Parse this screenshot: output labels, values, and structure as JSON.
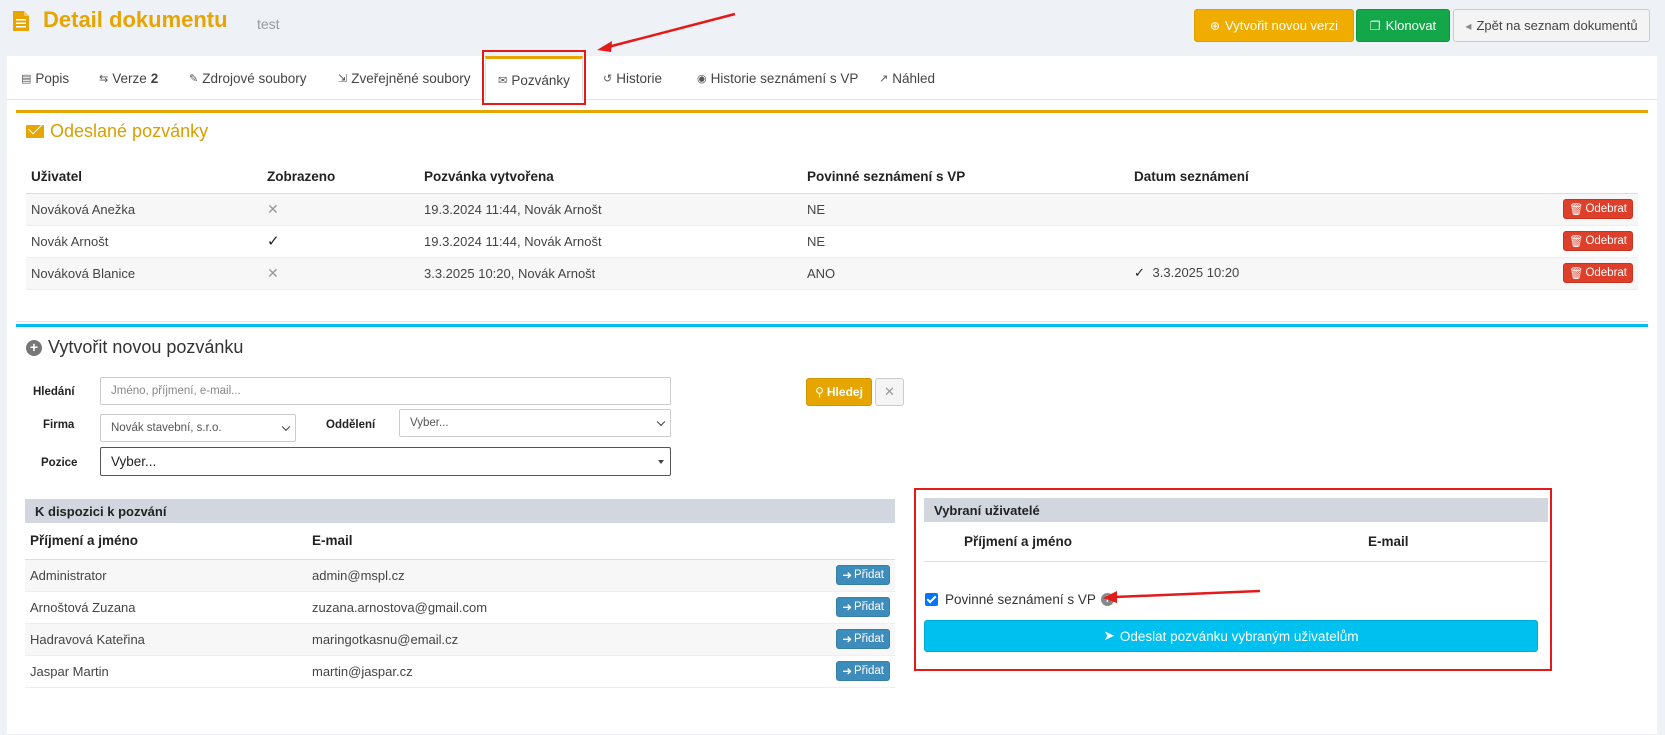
{
  "header": {
    "title": "Detail dokumentu",
    "subtitle": "test",
    "buttons": {
      "new_version": "Vytvořit novou verzi",
      "clone": "Klonovat",
      "back": "Zpět na seznam dokumentů"
    }
  },
  "tabs": [
    {
      "label": "Popis",
      "icon": "file-icon"
    },
    {
      "label": "Verze",
      "badge": "2",
      "icon": "swap-icon"
    },
    {
      "label": "Zdrojové soubory",
      "icon": "file-edit-icon"
    },
    {
      "label": "Zveřejněné soubory",
      "icon": "file-export-icon"
    },
    {
      "label": "Pozvánky",
      "icon": "envelope-icon",
      "active": true
    },
    {
      "label": "Historie",
      "icon": "history-icon"
    },
    {
      "label": "Historie seznámení s VP",
      "icon": "eye-icon"
    },
    {
      "label": "Náhled",
      "icon": "external-link-icon"
    }
  ],
  "sent_invitations": {
    "title": "Odeslané pozvánky",
    "columns": [
      "Uživatel",
      "Zobrazeno",
      "Pozvánka vytvořena",
      "Povinné seznámení s VP",
      "Datum seznámení"
    ],
    "rows": [
      {
        "user": "Nováková Anežka",
        "seen": false,
        "created": "19.3.2024 11:44, Novák Arnošt",
        "mandatory": "NE",
        "date": "",
        "action": "Odebrat"
      },
      {
        "user": "Novák Arnošt",
        "seen": true,
        "created": "19.3.2024 11:44, Novák Arnošt",
        "mandatory": "NE",
        "date": "",
        "action": "Odebrat"
      },
      {
        "user": "Nováková Blanice",
        "seen": false,
        "created": "3.3.2025 10:20, Novák Arnošt",
        "mandatory": "ANO",
        "date": "3.3.2025 10:20",
        "action": "Odebrat"
      }
    ]
  },
  "new_invitation": {
    "title": "Vytvořit novou pozvánku",
    "search_label": "Hledání",
    "search_placeholder": "Jméno, příjmení, e-mail...",
    "search_button": "Hledej",
    "clear_button": "✕",
    "company_label": "Firma",
    "company_value": "Novák stavební, s.r.o.",
    "department_label": "Oddělení",
    "department_value": "Vyber...",
    "position_label": "Pozice",
    "position_value": "Vyber..."
  },
  "available": {
    "title": "K dispozici k pozvání",
    "columns": [
      "Příjmení a jméno",
      "E-mail"
    ],
    "rows": [
      {
        "name": "Administrator",
        "email": "admin@mspl.cz",
        "action": "Přidat"
      },
      {
        "name": "Arnoštová Zuzana",
        "email": "zuzana.arnostova@gmail.com",
        "action": "Přidat"
      },
      {
        "name": "Hadravová Kateřina",
        "email": "maringotkasnu@email.cz",
        "action": "Přidat"
      },
      {
        "name": "Jaspar Martin",
        "email": "martin@jaspar.cz",
        "action": "Přidat"
      }
    ]
  },
  "selected": {
    "title": "Vybraní uživatelé",
    "columns": [
      "Příjmení a jméno",
      "E-mail"
    ],
    "checkbox_label": "Povinné seznámení s VP",
    "checkbox_checked": true,
    "send_button": "Odeslat pozvánku vybraným uživatelům"
  },
  "colors": {
    "accent": "#e6a500",
    "success": "#13a74a",
    "danger": "#de3f2b",
    "info": "#00c0ef",
    "primary": "#3c8dbc",
    "annotation": "#e41a1a"
  }
}
